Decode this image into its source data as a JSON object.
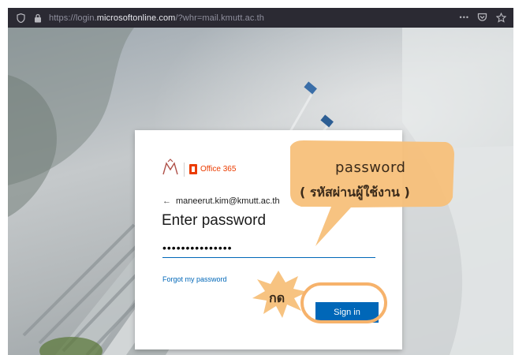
{
  "browser": {
    "url_prefix": "https://login.",
    "url_host": "microsoftonline.com",
    "url_suffix": "/?whr=mail.kmutt.ac.th",
    "menu_glyph": "•••"
  },
  "login": {
    "brand_text": "Office 365",
    "account": "maneerut.kim@kmutt.ac.th",
    "heading": "Enter password",
    "password_value": "•••••••••••••••",
    "forgot_link": "Forgot my password",
    "signin_label": "Sign in"
  },
  "annotations": {
    "password_en": "password",
    "password_th": "( รหัสผ่านผู้ใช้งาน )",
    "press": "กด",
    "callout_color": "#f7c07a",
    "highlight_color": "#f6b26b"
  }
}
